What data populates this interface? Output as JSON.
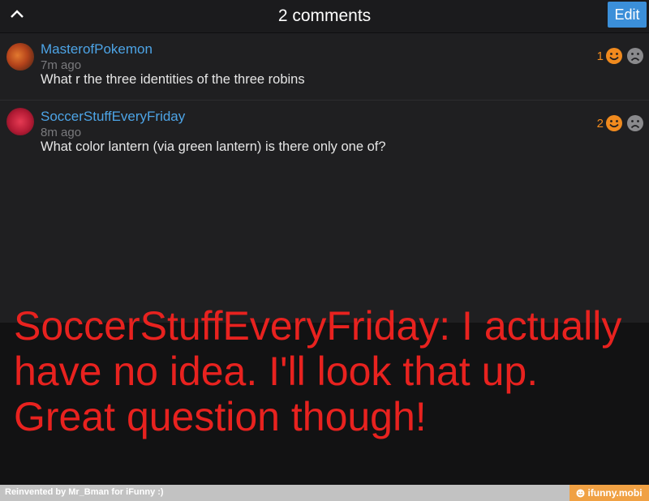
{
  "header": {
    "title": "2 comments",
    "edit_label": "Edit",
    "back_icon": "chevron-up-icon"
  },
  "comments": [
    {
      "username": "MasterofPokemon",
      "time": "7m ago",
      "text": "What r the three identities of the three robins",
      "score": "1"
    },
    {
      "username": "SoccerStuffEveryFriday",
      "time": "8m ago",
      "text": "What color lantern (via green lantern) is there only one of?",
      "score": "2"
    }
  ],
  "caption": "SoccerStuffEveryFriday: I actually have no idea. I'll look that up. Great question though!",
  "footer": {
    "credit": "Reinvented by Mr_Bman for iFunny :)",
    "site": "ifunny.mobi"
  },
  "colors": {
    "accent": "#3b8fd9",
    "username": "#4da4e6",
    "score": "#f08a1e",
    "caption": "#e8221f"
  }
}
